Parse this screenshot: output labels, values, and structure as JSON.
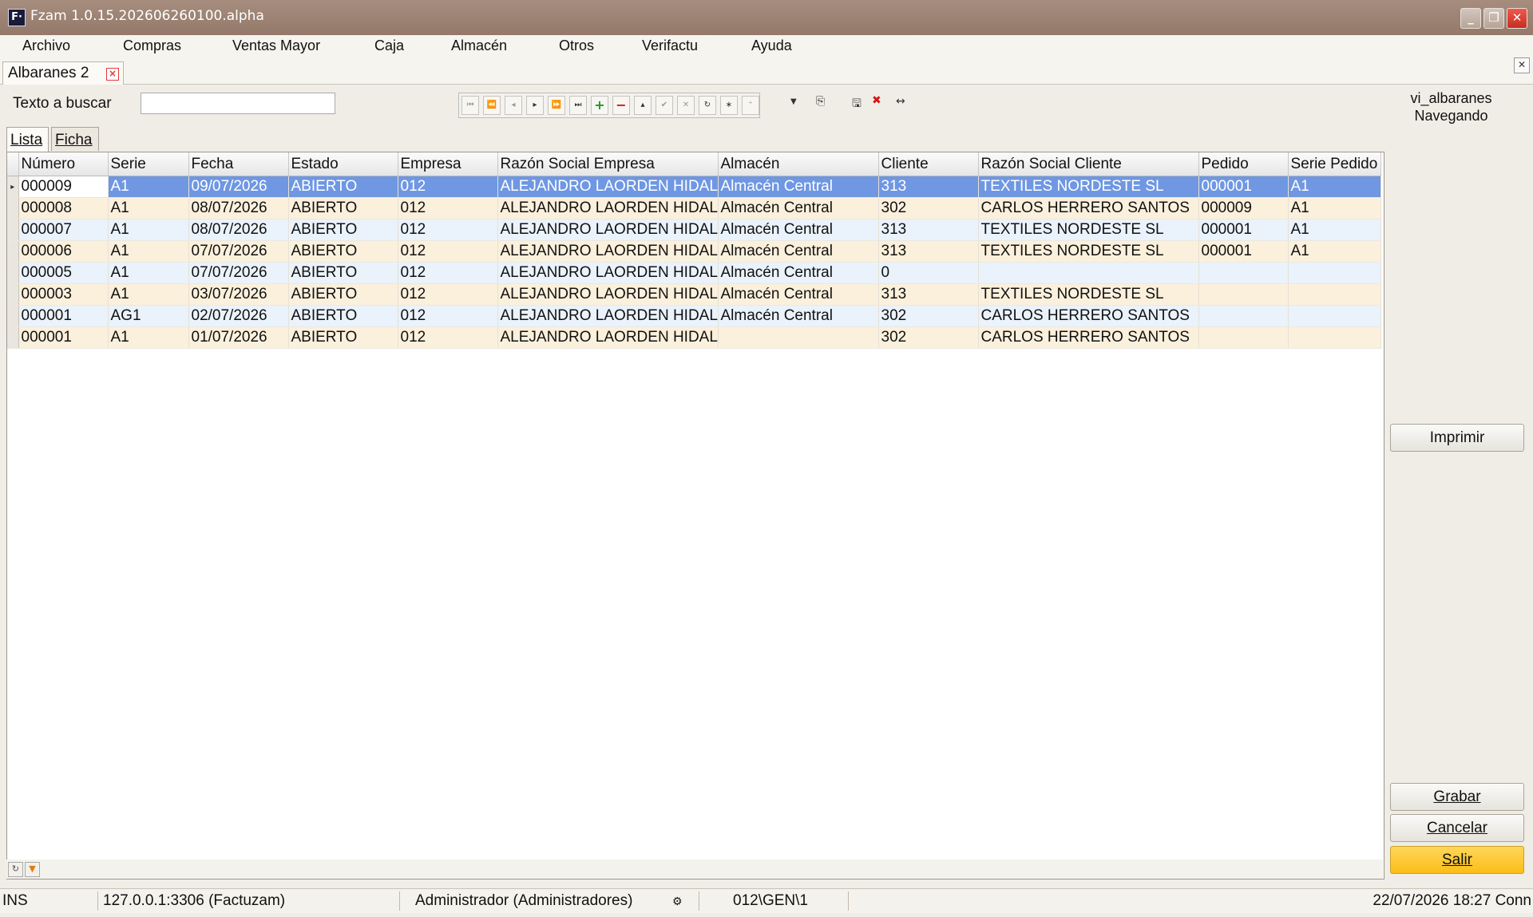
{
  "window": {
    "title": "Fzam 1.0.15.202606260100.alpha",
    "app_icon": "F·"
  },
  "menu": [
    "Archivo",
    "Compras",
    "Ventas Mayor",
    "Caja",
    "Almacén",
    "Otros",
    "Verifactu",
    "Ayuda"
  ],
  "doc_tab": {
    "label": "Albaranes 2"
  },
  "search": {
    "label": "Texto a buscar",
    "value": ""
  },
  "view": {
    "name": "vi_albaranes",
    "mode": "Navegando"
  },
  "subtabs": [
    "Lista",
    "Ficha"
  ],
  "grid": {
    "columns": [
      "Número",
      "Serie",
      "Fecha",
      "Estado",
      "Empresa",
      "Razón Social Empresa",
      "Almacén",
      "Cliente",
      "Razón Social Cliente",
      "Pedido",
      "Serie Pedido"
    ],
    "rows": [
      [
        "000009",
        "A1",
        "09/07/2026",
        "ABIERTO",
        "012",
        "ALEJANDRO LAORDEN HIDALGO",
        "Almacén Central",
        "313",
        "TEXTILES NORDESTE SL",
        "000001",
        "A1"
      ],
      [
        "000008",
        "A1",
        "08/07/2026",
        "ABIERTO",
        "012",
        "ALEJANDRO LAORDEN HIDALGO",
        "Almacén Central",
        "302",
        "CARLOS HERRERO SANTOS",
        "000009",
        "A1"
      ],
      [
        "000007",
        "A1",
        "08/07/2026",
        "ABIERTO",
        "012",
        "ALEJANDRO LAORDEN HIDALGO",
        "Almacén Central",
        "313",
        "TEXTILES NORDESTE SL",
        "000001",
        "A1"
      ],
      [
        "000006",
        "A1",
        "07/07/2026",
        "ABIERTO",
        "012",
        "ALEJANDRO LAORDEN HIDALGO",
        "Almacén Central",
        "313",
        "TEXTILES NORDESTE SL",
        "000001",
        "A1"
      ],
      [
        "000005",
        "A1",
        "07/07/2026",
        "ABIERTO",
        "012",
        "ALEJANDRO LAORDEN HIDALGO",
        "Almacén Central",
        "0",
        "",
        "",
        ""
      ],
      [
        "000003",
        "A1",
        "03/07/2026",
        "ABIERTO",
        "012",
        "ALEJANDRO LAORDEN HIDALGO",
        "Almacén Central",
        "313",
        "TEXTILES NORDESTE SL",
        "",
        ""
      ],
      [
        "000001",
        "AG1",
        "02/07/2026",
        "ABIERTO",
        "012",
        "ALEJANDRO LAORDEN HIDALGO",
        "Almacén Central",
        "302",
        "CARLOS HERRERO SANTOS",
        "",
        ""
      ],
      [
        "000001",
        "A1",
        "01/07/2026",
        "ABIERTO",
        "012",
        "ALEJANDRO LAORDEN HIDALGO",
        "",
        "302",
        "CARLOS HERRERO SANTOS",
        "",
        ""
      ]
    ]
  },
  "buttons": {
    "print": "Imprimir",
    "save": "Grabar",
    "cancel": "Cancelar",
    "exit": "Salir"
  },
  "status": {
    "mode": "INS",
    "connection": "127.0.0.1:3306 (Factuzam)",
    "user": "Administrador (Administradores)",
    "company": "012\\GEN\\1",
    "datetime": "22/07/2026 18:27 Conn"
  },
  "colors": {
    "selected_row": "#6f97e2",
    "row_odd": "#eaf2fb",
    "row_even": "#fbf0dc",
    "exit_button": "#fbbd16"
  }
}
